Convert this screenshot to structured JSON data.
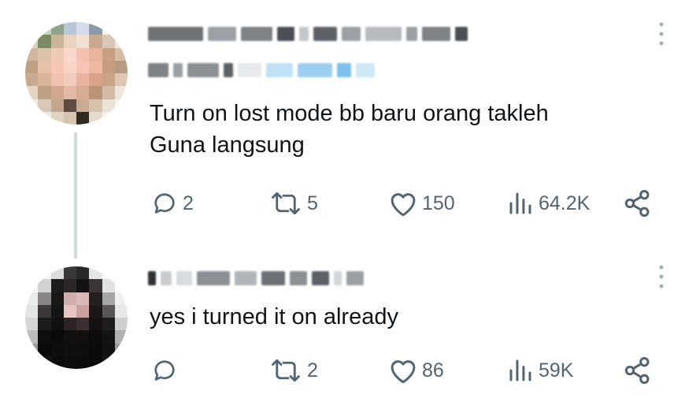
{
  "tweets": [
    {
      "text": "Turn on lost mode bb baru orang takleh\nGuna langsung",
      "replies": "2",
      "retweets": "5",
      "likes": "150",
      "views": "64.2K"
    },
    {
      "text": "yes i turned it on already",
      "replies": "",
      "retweets": "2",
      "likes": "86",
      "views": "59K"
    }
  ],
  "icons": {
    "reply": "reply-icon",
    "retweet": "retweet-icon",
    "like": "heart-icon",
    "views": "views-icon",
    "share": "share-icon",
    "more": "more-vertical-icon"
  },
  "colors": {
    "text": "#0f1419",
    "muted": "#536471",
    "thread_line": "#cfd9de"
  }
}
